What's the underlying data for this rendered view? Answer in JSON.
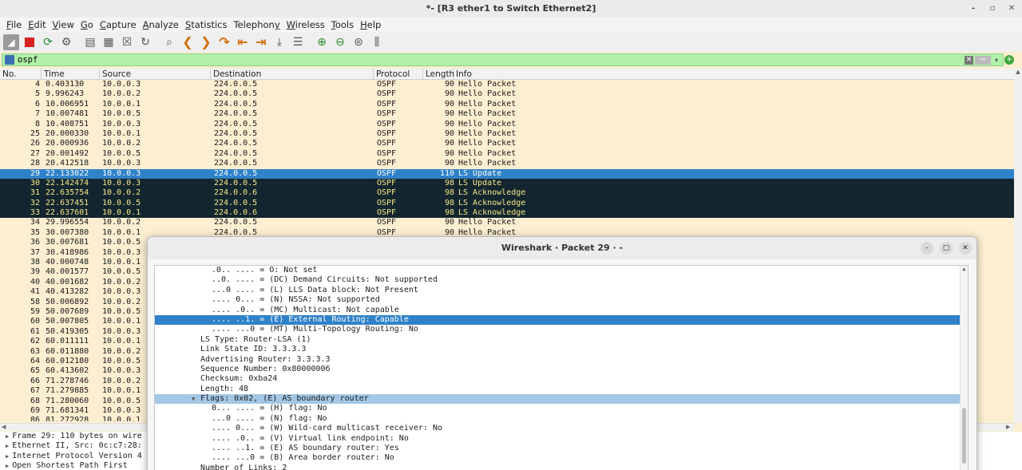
{
  "window": {
    "title": "*- [R3 ether1 to Switch Ethernet2]",
    "controls": {
      "minimize": "–",
      "maximize": "▫",
      "close": "✕"
    }
  },
  "menu": [
    {
      "ul": "F",
      "rest": "ile"
    },
    {
      "ul": "E",
      "rest": "dit"
    },
    {
      "ul": "V",
      "rest": "iew"
    },
    {
      "ul": "G",
      "rest": "o"
    },
    {
      "ul": "C",
      "rest": "apture"
    },
    {
      "ul": "A",
      "rest": "nalyze"
    },
    {
      "ul": "S",
      "rest": "tatistics"
    },
    {
      "pre": "Telephon",
      "ul": "y",
      "rest": ""
    },
    {
      "ul": "W",
      "rest": "ireless"
    },
    {
      "ul": "T",
      "rest": "ools"
    },
    {
      "ul": "H",
      "rest": "elp"
    }
  ],
  "toolbar_icons": [
    "shark-fin-icon",
    "stop-capture-icon",
    "restart-capture-icon",
    "capture-options-icon",
    "open-file-icon",
    "save-file-icon",
    "close-file-icon",
    "reload-file-icon",
    "find-packet-icon",
    "go-back-icon",
    "go-forward-icon",
    "go-to-packet-icon",
    "go-first-icon",
    "go-last-icon",
    "auto-scroll-icon",
    "colorize-icon",
    "zoom-in-icon",
    "zoom-out-icon",
    "normal-size-icon",
    "resize-columns-icon"
  ],
  "filter": {
    "value": "ospf",
    "clear": "✕",
    "apply": "⇨",
    "dropdown": "▾",
    "add": "+"
  },
  "packet_list": {
    "columns": [
      "No.",
      "Time",
      "Source",
      "Destination",
      "Protocol",
      "Length",
      "Info"
    ],
    "rows": [
      {
        "no": "4",
        "time": "0.403130",
        "src": "10.0.0.3",
        "dst": "224.0.0.5",
        "proto": "OSPF",
        "len": "90",
        "info": "Hello Packet",
        "style": ""
      },
      {
        "no": "5",
        "time": "9.996243",
        "src": "10.0.0.2",
        "dst": "224.0.0.5",
        "proto": "OSPF",
        "len": "90",
        "info": "Hello Packet",
        "style": ""
      },
      {
        "no": "6",
        "time": "10.006951",
        "src": "10.0.0.1",
        "dst": "224.0.0.5",
        "proto": "OSPF",
        "len": "90",
        "info": "Hello Packet",
        "style": ""
      },
      {
        "no": "7",
        "time": "10.007481",
        "src": "10.0.0.5",
        "dst": "224.0.0.5",
        "proto": "OSPF",
        "len": "90",
        "info": "Hello Packet",
        "style": ""
      },
      {
        "no": "8",
        "time": "10.408751",
        "src": "10.0.0.3",
        "dst": "224.0.0.5",
        "proto": "OSPF",
        "len": "90",
        "info": "Hello Packet",
        "style": ""
      },
      {
        "no": "25",
        "time": "20.000330",
        "src": "10.0.0.1",
        "dst": "224.0.0.5",
        "proto": "OSPF",
        "len": "90",
        "info": "Hello Packet",
        "style": ""
      },
      {
        "no": "26",
        "time": "20.000936",
        "src": "10.0.0.2",
        "dst": "224.0.0.5",
        "proto": "OSPF",
        "len": "90",
        "info": "Hello Packet",
        "style": ""
      },
      {
        "no": "27",
        "time": "20.001492",
        "src": "10.0.0.5",
        "dst": "224.0.0.5",
        "proto": "OSPF",
        "len": "90",
        "info": "Hello Packet",
        "style": ""
      },
      {
        "no": "28",
        "time": "20.412518",
        "src": "10.0.0.3",
        "dst": "224.0.0.5",
        "proto": "OSPF",
        "len": "90",
        "info": "Hello Packet",
        "style": ""
      },
      {
        "no": "29",
        "time": "22.133022",
        "src": "10.0.0.3",
        "dst": "224.0.0.5",
        "proto": "OSPF",
        "len": "110",
        "info": "LS Update",
        "style": "sel"
      },
      {
        "no": "30",
        "time": "22.142474",
        "src": "10.0.0.3",
        "dst": "224.0.0.5",
        "proto": "OSPF",
        "len": "98",
        "info": "LS Update",
        "style": "dark"
      },
      {
        "no": "31",
        "time": "22.635754",
        "src": "10.0.0.2",
        "dst": "224.0.0.6",
        "proto": "OSPF",
        "len": "98",
        "info": "LS Acknowledge",
        "style": "dark"
      },
      {
        "no": "32",
        "time": "22.637451",
        "src": "10.0.0.5",
        "dst": "224.0.0.5",
        "proto": "OSPF",
        "len": "98",
        "info": "LS Acknowledge",
        "style": "dark"
      },
      {
        "no": "33",
        "time": "22.637601",
        "src": "10.0.0.1",
        "dst": "224.0.0.6",
        "proto": "OSPF",
        "len": "98",
        "info": "LS Acknowledge",
        "style": "dark"
      },
      {
        "no": "34",
        "time": "29.996554",
        "src": "10.0.0.2",
        "dst": "224.0.0.5",
        "proto": "OSPF",
        "len": "90",
        "info": "Hello Packet",
        "style": ""
      },
      {
        "no": "35",
        "time": "30.007380",
        "src": "10.0.0.1",
        "dst": "224.0.0.5",
        "proto": "OSPF",
        "len": "90",
        "info": "Hello Packet",
        "style": ""
      },
      {
        "no": "36",
        "time": "30.007681",
        "src": "10.0.0.5",
        "dst": "",
        "proto": "",
        "len": "",
        "info": "",
        "style": ""
      },
      {
        "no": "37",
        "time": "30.418986",
        "src": "10.0.0.3",
        "dst": "",
        "proto": "",
        "len": "",
        "info": "",
        "style": ""
      },
      {
        "no": "38",
        "time": "40.000748",
        "src": "10.0.0.1",
        "dst": "",
        "proto": "",
        "len": "",
        "info": "",
        "style": ""
      },
      {
        "no": "39",
        "time": "40.001577",
        "src": "10.0.0.5",
        "dst": "",
        "proto": "",
        "len": "",
        "info": "",
        "style": ""
      },
      {
        "no": "40",
        "time": "40.001682",
        "src": "10.0.0.2",
        "dst": "",
        "proto": "",
        "len": "",
        "info": "",
        "style": ""
      },
      {
        "no": "41",
        "time": "40.413282",
        "src": "10.0.0.3",
        "dst": "",
        "proto": "",
        "len": "",
        "info": "",
        "style": ""
      },
      {
        "no": "58",
        "time": "50.006892",
        "src": "10.0.0.2",
        "dst": "",
        "proto": "",
        "len": "",
        "info": "",
        "style": ""
      },
      {
        "no": "59",
        "time": "50.007689",
        "src": "10.0.0.5",
        "dst": "",
        "proto": "",
        "len": "",
        "info": "",
        "style": ""
      },
      {
        "no": "60",
        "time": "50.007805",
        "src": "10.0.0.1",
        "dst": "",
        "proto": "",
        "len": "",
        "info": "",
        "style": ""
      },
      {
        "no": "61",
        "time": "50.419305",
        "src": "10.0.0.3",
        "dst": "",
        "proto": "",
        "len": "",
        "info": "",
        "style": ""
      },
      {
        "no": "62",
        "time": "60.011111",
        "src": "10.0.0.1",
        "dst": "",
        "proto": "",
        "len": "",
        "info": "",
        "style": ""
      },
      {
        "no": "63",
        "time": "60.011880",
        "src": "10.0.0.2",
        "dst": "",
        "proto": "",
        "len": "",
        "info": "",
        "style": ""
      },
      {
        "no": "64",
        "time": "60.012180",
        "src": "10.0.0.5",
        "dst": "",
        "proto": "",
        "len": "",
        "info": "",
        "style": ""
      },
      {
        "no": "65",
        "time": "60.413602",
        "src": "10.0.0.3",
        "dst": "",
        "proto": "",
        "len": "",
        "info": "",
        "style": ""
      },
      {
        "no": "66",
        "time": "71.278746",
        "src": "10.0.0.2",
        "dst": "",
        "proto": "",
        "len": "",
        "info": "",
        "style": ""
      },
      {
        "no": "67",
        "time": "71.279885",
        "src": "10.0.0.1",
        "dst": "",
        "proto": "",
        "len": "",
        "info": "",
        "style": ""
      },
      {
        "no": "68",
        "time": "71.280060",
        "src": "10.0.0.5",
        "dst": "",
        "proto": "",
        "len": "",
        "info": "",
        "style": ""
      },
      {
        "no": "69",
        "time": "71.681341",
        "src": "10.0.0.3",
        "dst": "",
        "proto": "",
        "len": "",
        "info": "",
        "style": ""
      },
      {
        "no": "86",
        "time": "81.272928",
        "src": "10.0.0.1",
        "dst": "",
        "proto": "",
        "len": "",
        "info": "",
        "style": ""
      }
    ]
  },
  "details": [
    {
      "text": "Frame 29: 110 bytes on wire"
    },
    {
      "text": "Ethernet II, Src: 0c:c7:28:"
    },
    {
      "text": "Internet Protocol Version 4"
    },
    {
      "text": "Open Shortest Path First"
    }
  ],
  "dialog": {
    "title": "Wireshark · Packet 29 · -",
    "controls": {
      "minimize": "–",
      "maximize": "▢",
      "close": "✕"
    },
    "tree": [
      {
        "indent": 6,
        "text": ".0.. .... = O: Not set",
        "style": ""
      },
      {
        "indent": 6,
        "text": "..0. .... = (DC) Demand Circuits: Not supported",
        "style": ""
      },
      {
        "indent": 6,
        "text": "...0 .... = (L) LLS Data block: Not Present",
        "style": ""
      },
      {
        "indent": 6,
        "text": ".... 0... = (N) NSSA: Not supported",
        "style": ""
      },
      {
        "indent": 6,
        "text": ".... .0.. = (MC) Multicast: Not capable",
        "style": ""
      },
      {
        "indent": 6,
        "text": ".... ..1. = (E) External Routing: Capable",
        "style": "sel"
      },
      {
        "indent": 6,
        "text": ".... ...0 = (MT) Multi-Topology Routing: No",
        "style": ""
      },
      {
        "indent": 4,
        "text": "LS Type: Router-LSA (1)",
        "style": ""
      },
      {
        "indent": 4,
        "text": "Link State ID: 3.3.3.3",
        "style": ""
      },
      {
        "indent": 4,
        "text": "Advertising Router: 3.3.3.3",
        "style": ""
      },
      {
        "indent": 4,
        "text": "Sequence Number: 0x80000006",
        "style": ""
      },
      {
        "indent": 4,
        "text": "Checksum: 0xba24",
        "style": ""
      },
      {
        "indent": 4,
        "text": "Length: 48",
        "style": ""
      },
      {
        "indent": 4,
        "text": "Flags: 0x02, (E) AS boundary router",
        "style": "hl",
        "expanded": true
      },
      {
        "indent": 6,
        "text": "0... .... = (H) flag: No",
        "style": ""
      },
      {
        "indent": 6,
        "text": "...0 .... = (N) flag: No",
        "style": ""
      },
      {
        "indent": 6,
        "text": ".... 0... = (W) Wild-card multicast receiver: No",
        "style": ""
      },
      {
        "indent": 6,
        "text": ".... .0.. = (V) Virtual link endpoint: No",
        "style": ""
      },
      {
        "indent": 6,
        "text": ".... ..1. = (E) AS boundary router: Yes",
        "style": ""
      },
      {
        "indent": 6,
        "text": ".... ...0 = (B) Area border router: No",
        "style": ""
      },
      {
        "indent": 4,
        "text": "Number of Links: 2",
        "style": ""
      }
    ]
  },
  "colors": {
    "row_default": "#fbeed1",
    "row_selected": "#2f82c8",
    "row_dark": "#13252e",
    "row_dark_text": "#f6e88a",
    "filter_bg": "#b0f0a8"
  }
}
